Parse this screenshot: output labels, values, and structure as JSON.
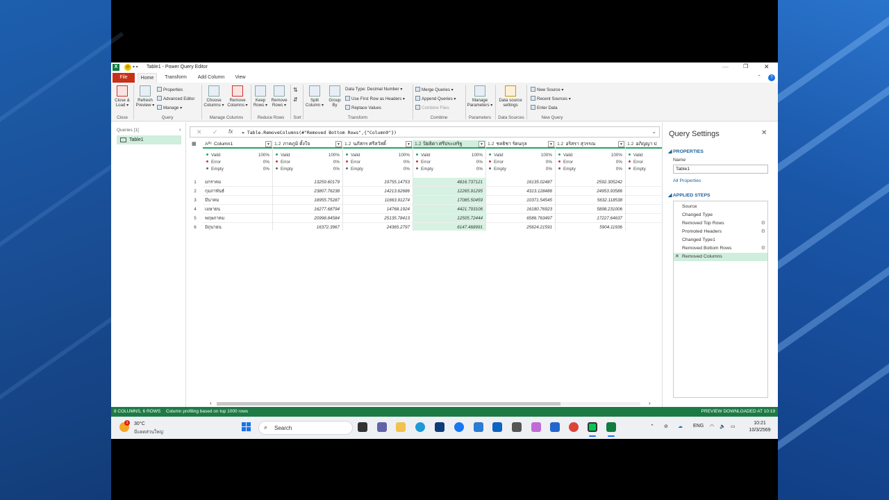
{
  "window": {
    "title": "Table1 - Power Query Editor",
    "tabs": [
      "File",
      "Home",
      "Transform",
      "Add Column",
      "View"
    ]
  },
  "ribbon": {
    "close_load": "Close &",
    "close_load2": "Load ▾",
    "refresh": "Refresh",
    "refresh2": "Preview ▾",
    "properties": "Properties",
    "advanced_editor": "Advanced Editor",
    "manage": "Manage ▾",
    "choose_columns": "Choose",
    "choose_columns2": "Columns ▾",
    "remove_columns": "Remove",
    "remove_columns2": "Columns ▾",
    "keep_rows": "Keep",
    "keep_rows2": "Rows ▾",
    "remove_rows": "Remove",
    "remove_rows2": "Rows ▾",
    "split_column": "Split",
    "split_column2": "Column ▾",
    "group_by": "Group",
    "group_by2": "By",
    "data_type": "Data Type: Decimal Number ▾",
    "first_row_headers": "Use First Row as Headers ▾",
    "replace_values": "Replace Values",
    "merge_queries": "Merge Queries ▾",
    "append_queries": "Append Queries ▾",
    "combine_files": "Combine Files",
    "manage_parameters": "Manage",
    "manage_parameters2": "Parameters ▾",
    "data_source_settings": "Data source",
    "data_source_settings2": "settings",
    "new_source": "New Source ▾",
    "recent_sources": "Recent Sources ▾",
    "enter_data": "Enter Data",
    "groups": [
      "Close",
      "Query",
      "Manage Columns",
      "Reduce Rows",
      "Sort",
      "Transform",
      "Combine",
      "Parameters",
      "Data Sources",
      "New Query"
    ]
  },
  "queries": {
    "header": "Queries [1]",
    "items": [
      "Table1"
    ]
  },
  "formula_bar": {
    "formula": "= Table.RemoveColumns(#\"Removed Bottom Rows\",{\"Column9\"})"
  },
  "grid": {
    "columns": [
      {
        "type": "Aᴬᶜ",
        "name": "Column1"
      },
      {
        "type": "1.2",
        "name": "ภาคภูมิ ตั้งใจ"
      },
      {
        "type": "1.2",
        "name": "นภัสกร ศรีสวัสดิ์"
      },
      {
        "type": "1.2",
        "name": "ปิยธิดา ศรีประเสริฐ"
      },
      {
        "type": "1.2",
        "name": "ชลธิชา รัตนกุล"
      },
      {
        "type": "1.2",
        "name": "อริสรา สุวรรณ"
      },
      {
        "type": "1.2",
        "name": "อภิญญา ป"
      }
    ],
    "profile_labels": [
      "Valid",
      "Error",
      "Empty"
    ],
    "profile_values": [
      "100%",
      "0%",
      "0%"
    ],
    "rows": [
      [
        "มกราคม",
        "13259.60179",
        "19755.14753",
        "4816.737121",
        "16135.02487",
        "2592.305242"
      ],
      [
        "กุมภาพันธ์",
        "23807.76238",
        "14213.62686",
        "12265.91295",
        "4313.128486",
        "24953.93586"
      ],
      [
        "มีนาคม",
        "18955.75287",
        "11663.91274",
        "17085.50459",
        "10371.54545",
        "5632.118538"
      ],
      [
        "เมษายน",
        "16277.68794",
        "14768.1924",
        "4421.793106",
        "16180.76923",
        "5898.231006"
      ],
      [
        "พฤษภาคม",
        "20998.84584",
        "25135.78413",
        "12505.72444",
        "6586.763497",
        "17227.64637"
      ],
      [
        "มิถุนายน",
        "16372.3967",
        "24365.2797",
        "6147.468991",
        "25624.21591",
        "5904.11936"
      ]
    ]
  },
  "settings": {
    "title": "Query Settings",
    "properties": "PROPERTIES",
    "name_label": "Name",
    "name_value": "Table1",
    "all_properties": "All Properties",
    "applied_steps": "APPLIED STEPS",
    "steps": [
      "Source",
      "Changed Type",
      "Removed Top Rows",
      "Promoted Headers",
      "Changed Type1",
      "Removed Bottom Rows",
      "Removed Columns"
    ]
  },
  "status": {
    "left": "8 COLUMNS, 6 ROWS",
    "middle": "Column profiling based on top 1000 rows",
    "right": "PREVIEW DOWNLOADED AT 10:19"
  },
  "taskbar": {
    "weather_badge": "1",
    "temperature": "30°C",
    "condition": "มีแดดส่วนใหญ่",
    "search": "Search",
    "lang": "ENG",
    "time": "10:21",
    "date": "10/3/2569"
  },
  "colors": {
    "accent_green": "#21a366",
    "status_green": "#1d7a45",
    "file_tab": "#c7311a",
    "highlight": "#cfeedd"
  }
}
